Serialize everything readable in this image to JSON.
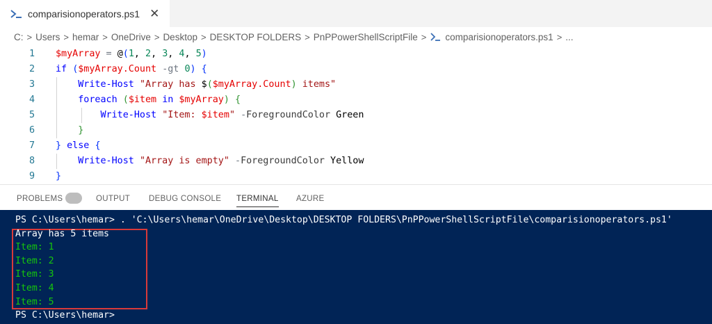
{
  "tab": {
    "title": "comparisionoperators.ps1",
    "close_glyph": "✕"
  },
  "breadcrumb": {
    "items": [
      "C:",
      "Users",
      "hemar",
      "OneDrive",
      "Desktop",
      "DESKTOP FOLDERS",
      "PnPPowerShellScriptFile",
      "comparisionoperators.ps1",
      "..."
    ],
    "separator": ">"
  },
  "editor": {
    "line_numbers": [
      "1",
      "2",
      "3",
      "4",
      "5",
      "6",
      "7",
      "8",
      "9"
    ],
    "lines": [
      {
        "tokens": [
          [
            "var",
            "$myArray"
          ],
          [
            "op",
            " = "
          ],
          [
            "plain",
            "@"
          ],
          [
            "br1",
            "("
          ],
          [
            "num",
            "1"
          ],
          [
            "plain",
            ", "
          ],
          [
            "num",
            "2"
          ],
          [
            "plain",
            ", "
          ],
          [
            "num",
            "3"
          ],
          [
            "plain",
            ", "
          ],
          [
            "num",
            "4"
          ],
          [
            "plain",
            ", "
          ],
          [
            "num",
            "5"
          ],
          [
            "br1",
            ")"
          ]
        ]
      },
      {
        "tokens": [
          [
            "kw",
            "if"
          ],
          [
            "plain",
            " "
          ],
          [
            "br1",
            "("
          ],
          [
            "var",
            "$myArray.Count"
          ],
          [
            "plain",
            " "
          ],
          [
            "op",
            "-gt"
          ],
          [
            "plain",
            " "
          ],
          [
            "num",
            "0"
          ],
          [
            "br1",
            ")"
          ],
          [
            "plain",
            " "
          ],
          [
            "br1",
            "{"
          ]
        ]
      },
      {
        "tokens": [
          [
            "plain",
            "    "
          ],
          [
            "cmd",
            "Write-Host"
          ],
          [
            "plain",
            " "
          ],
          [
            "str",
            "\"Array has "
          ],
          [
            "plain",
            "$"
          ],
          [
            "br2",
            "("
          ],
          [
            "var",
            "$myArray.Count"
          ],
          [
            "br2",
            ")"
          ],
          [
            "str",
            " items\""
          ]
        ]
      },
      {
        "tokens": [
          [
            "plain",
            "    "
          ],
          [
            "kw",
            "foreach"
          ],
          [
            "plain",
            " "
          ],
          [
            "br2",
            "("
          ],
          [
            "var",
            "$item"
          ],
          [
            "plain",
            " "
          ],
          [
            "kw",
            "in"
          ],
          [
            "plain",
            " "
          ],
          [
            "var",
            "$myArray"
          ],
          [
            "br2",
            ")"
          ],
          [
            "plain",
            " "
          ],
          [
            "br2",
            "{"
          ]
        ]
      },
      {
        "tokens": [
          [
            "plain",
            "        "
          ],
          [
            "cmd",
            "Write-Host"
          ],
          [
            "plain",
            " "
          ],
          [
            "str",
            "\"Item: "
          ],
          [
            "var",
            "$item"
          ],
          [
            "str",
            "\""
          ],
          [
            "plain",
            " "
          ],
          [
            "op",
            "-"
          ],
          [
            "param",
            "ForegroundColor"
          ],
          [
            "plain",
            " Green"
          ]
        ]
      },
      {
        "tokens": [
          [
            "plain",
            "    "
          ],
          [
            "br2",
            "}"
          ]
        ]
      },
      {
        "tokens": [
          [
            "br1",
            "}"
          ],
          [
            "plain",
            " "
          ],
          [
            "kw",
            "else"
          ],
          [
            "plain",
            " "
          ],
          [
            "br1",
            "{"
          ]
        ]
      },
      {
        "tokens": [
          [
            "plain",
            "    "
          ],
          [
            "cmd",
            "Write-Host"
          ],
          [
            "plain",
            " "
          ],
          [
            "str",
            "\"Array is empty\""
          ],
          [
            "plain",
            " "
          ],
          [
            "op",
            "-"
          ],
          [
            "param",
            "ForegroundColor"
          ],
          [
            "plain",
            " Yellow"
          ]
        ]
      },
      {
        "tokens": [
          [
            "br1",
            "}"
          ]
        ]
      }
    ]
  },
  "panel": {
    "tabs": [
      {
        "label": "PROBLEMS",
        "active": false
      },
      {
        "label": "OUTPUT",
        "active": false
      },
      {
        "label": "DEBUG CONSOLE",
        "active": false
      },
      {
        "label": "TERMINAL",
        "active": true
      },
      {
        "label": "AZURE",
        "active": false
      }
    ]
  },
  "terminal": {
    "lines": [
      {
        "text": "PS C:\\Users\\hemar> . 'C:\\Users\\hemar\\OneDrive\\Desktop\\DESKTOP FOLDERS\\PnPPowerShellScriptFile\\comparisionoperators.ps1'",
        "color": "#ffffff"
      },
      {
        "text": "Array has 5 items",
        "color": "#ffffff"
      },
      {
        "text": "Item: 1",
        "color": "#16c60c"
      },
      {
        "text": "Item: 2",
        "color": "#16c60c"
      },
      {
        "text": "Item: 3",
        "color": "#16c60c"
      },
      {
        "text": "Item: 4",
        "color": "#16c60c"
      },
      {
        "text": "Item: 5",
        "color": "#16c60c"
      },
      {
        "text": "PS C:\\Users\\hemar>",
        "color": "#ffffff"
      }
    ]
  },
  "colors": {
    "terminal_bg": "#012456",
    "highlight_box": "#d93a3a",
    "ps_icon": "#3b6fb6"
  },
  "icons": {
    "tab_icon": "powershell-icon",
    "breadcrumb_file_icon": "powershell-icon"
  }
}
